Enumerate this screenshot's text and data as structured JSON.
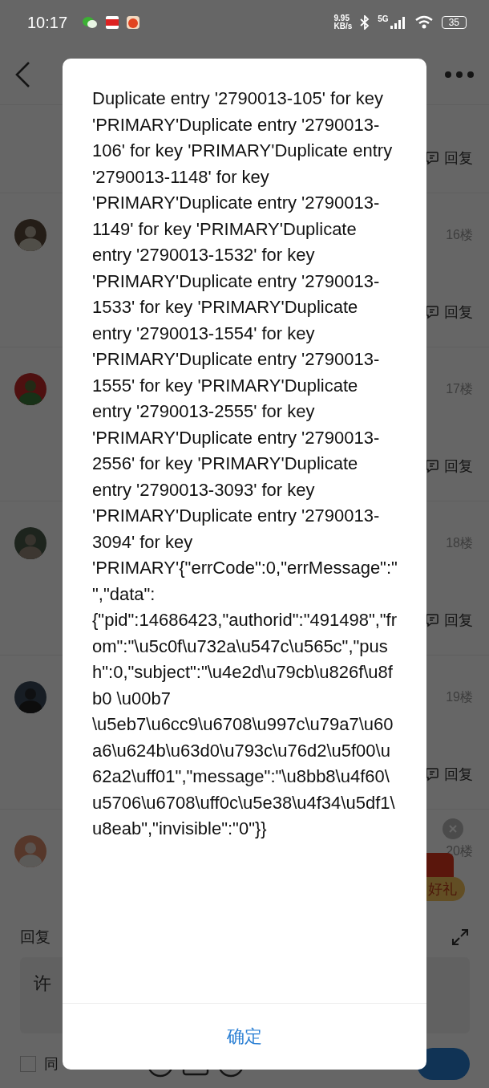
{
  "status_bar": {
    "time": "10:17",
    "speed_value": "9.95",
    "speed_unit": "KB/s",
    "network": "5G",
    "battery": "35"
  },
  "posts": [
    {
      "reply": "回复"
    },
    {
      "floor": "16楼",
      "reply": "回复"
    },
    {
      "floor": "17楼",
      "reply": "回复"
    },
    {
      "floor": "18楼",
      "reply": "回复"
    },
    {
      "floor": "19楼",
      "reply": "回复"
    },
    {
      "floor": "20楼"
    }
  ],
  "promo": {
    "label": "好礼"
  },
  "reply_panel": {
    "title": "回复",
    "value": "许",
    "agree": {
      "label": "同",
      "checked": false
    }
  },
  "dialog": {
    "message": "Duplicate entry '2790013-105' for key 'PRIMARY'Duplicate entry '2790013-106' for key 'PRIMARY'Duplicate entry '2790013-1148' for key 'PRIMARY'Duplicate entry '2790013-1149' for key 'PRIMARY'Duplicate entry '2790013-1532' for key 'PRIMARY'Duplicate entry '2790013-1533' for key 'PRIMARY'Duplicate entry '2790013-1554' for key 'PRIMARY'Duplicate entry '2790013-1555' for key 'PRIMARY'Duplicate entry '2790013-2555' for key 'PRIMARY'Duplicate entry '2790013-2556' for key 'PRIMARY'Duplicate entry '2790013-3093' for key 'PRIMARY'Duplicate entry '2790013-3094' for key 'PRIMARY'{\"errCode\":0,\"errMessage\":\"\",\"data\":{\"pid\":14686423,\"authorid\":\"491498\",\"from\":\"\\u5c0f\\u732a\\u547c\\u565c\",\"push\":0,\"subject\":\"\\u4e2d\\u79cb\\u826f\\u8fb0 \\u00b7 \\u5eb7\\u6cc9\\u6708\\u997c\\u79a7\\u60a6\\u624b\\u63d0\\u793c\\u76d2\\u5f00\\u62a2\\uff01\",\"message\":\"\\u8bb8\\u4f60\\u5706\\u6708\\uff0c\\u5e38\\u4f34\\u5df1\\u8eab\",\"invisible\":\"0\"}}",
    "confirm": "确定"
  }
}
